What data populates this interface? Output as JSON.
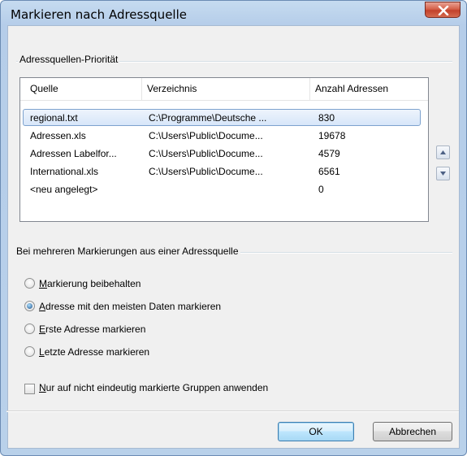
{
  "window": {
    "title": "Markieren nach Adressquelle"
  },
  "group1": {
    "label": "Adressquellen-Priorität"
  },
  "table": {
    "columns": [
      "Quelle",
      "Verzeichnis",
      "Anzahl Adressen"
    ],
    "rows": [
      [
        "regional.txt",
        "C:\\Programme\\Deutsche ...",
        "830"
      ],
      [
        "Adressen.xls",
        "C:\\Users\\Public\\Docume...",
        "19678"
      ],
      [
        "Adressen Labelfor...",
        "C:\\Users\\Public\\Docume...",
        "4579"
      ],
      [
        "International.xls",
        "C:\\Users\\Public\\Docume...",
        "6561"
      ],
      [
        "<neu angelegt>",
        "",
        "0"
      ]
    ],
    "selected_row": 0
  },
  "group2": {
    "label": "Bei mehreren Markierungen aus einer Adressquelle"
  },
  "radios": [
    {
      "accel": "M",
      "rest": "arkierung beibehalten",
      "checked": false
    },
    {
      "accel": "A",
      "rest": "dresse mit den meisten Daten markieren",
      "checked": true
    },
    {
      "accel": "E",
      "rest": "rste Adresse markieren",
      "checked": false
    },
    {
      "accel": "L",
      "rest": "etzte Adresse markieren",
      "checked": false
    }
  ],
  "checkbox": {
    "accel": "N",
    "rest": "ur auf nicht eindeutig markierte Gruppen anwenden",
    "checked": false
  },
  "buttons": {
    "ok": "OK",
    "cancel": "Abbrechen"
  },
  "icons": {
    "close": "close-icon",
    "up": "arrow-up-icon",
    "down": "arrow-down-icon"
  }
}
